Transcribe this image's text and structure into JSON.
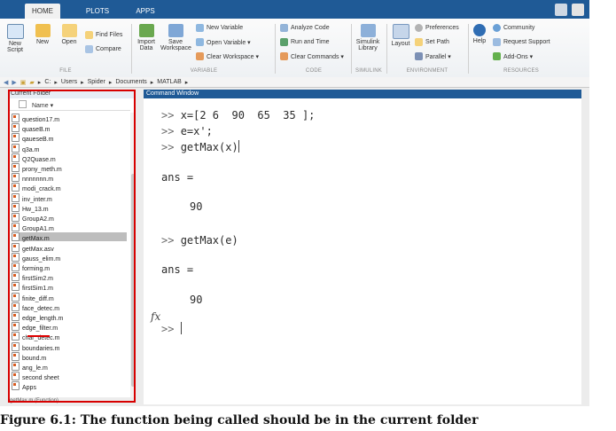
{
  "tabs": [
    "HOME",
    "PLOTS",
    "APPS"
  ],
  "ribbon": {
    "file": {
      "buttons": [
        {
          "label": "New\nScript"
        },
        {
          "label": "New"
        },
        {
          "label": "Open"
        }
      ],
      "small": [
        "Find Files",
        "Compare"
      ],
      "section": "FILE"
    },
    "variable": {
      "buttons": [
        {
          "label": "Import\nData"
        },
        {
          "label": "Save\nWorkspace"
        }
      ],
      "small": [
        "New Variable",
        "Open Variable ▾",
        "Clear Workspace ▾"
      ],
      "section": "VARIABLE"
    },
    "code": {
      "small": [
        "Analyze Code",
        "Run and Time",
        "Clear Commands ▾"
      ],
      "section": "CODE"
    },
    "simulink": {
      "button": {
        "label": "Simulink\nLibrary"
      },
      "section": "SIMULINK"
    },
    "environment": {
      "button": {
        "label": "Layout"
      },
      "small": [
        "Preferences",
        "Set Path",
        "Parallel ▾"
      ],
      "section": "ENVIRONMENT"
    },
    "resources": {
      "button": {
        "label": "Help"
      },
      "small": [
        "Community",
        "Request Support",
        "Add-Ons ▾"
      ],
      "section": "RESOURCES"
    }
  },
  "address": [
    "C:",
    "Users",
    "Spider",
    "Documents",
    "MATLAB"
  ],
  "current_folder": {
    "title": "Current Folder",
    "header": "Name ▾",
    "files": [
      "question17.m",
      "quaseB.m",
      "qaueseB.m",
      "q3a.m",
      "Q2Quase.m",
      "prony_meth.m",
      "nnnnnnn.m",
      "modi_crack.m",
      "inv_inter.m",
      "Hw_13.m",
      "GroupA2.m",
      "GroupA1.m",
      "getMax.m",
      "getMax.asv",
      "gauss_elim.m",
      "forming.m",
      "firstSim2.m",
      "firstSim1.m",
      "finite_diff.m",
      "face_detec.m",
      "edge_length.m",
      "edge_filter.m",
      "char_detec.m",
      "boundaries.m",
      "bound.m",
      "ang_le.m",
      "second sheet",
      "Apps"
    ],
    "status": "getMax.m (Function)"
  },
  "command_window": {
    "title": "Command Window",
    "lines": [
      {
        "prompt": ">>",
        "text": "x=[2 6  90  65  35 ];"
      },
      {
        "prompt": ">>",
        "text": "e=x';"
      },
      {
        "prompt": ">>",
        "text": "getMax(x)"
      },
      {
        "prompt": "",
        "text": "ans ="
      },
      {
        "prompt": "",
        "text": "90"
      },
      {
        "prompt": ">>",
        "text": "getMax(e)"
      },
      {
        "prompt": "",
        "text": "ans ="
      },
      {
        "prompt": "",
        "text": "90"
      },
      {
        "prompt": ">>",
        "text": ""
      }
    ],
    "fx_label": "fx"
  },
  "caption": "Figure 6.1: The function being called should be in the current folder"
}
